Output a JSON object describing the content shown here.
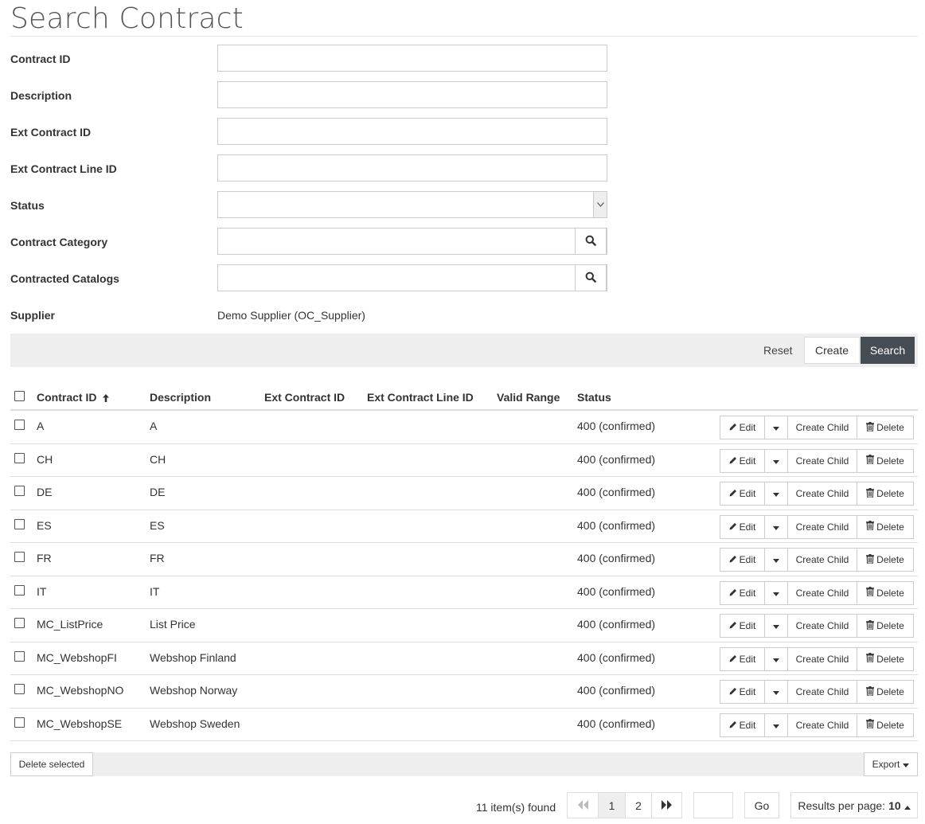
{
  "page": {
    "title": "Search Contract"
  },
  "form": {
    "contract_id": {
      "label": "Contract ID",
      "value": ""
    },
    "description": {
      "label": "Description",
      "value": ""
    },
    "ext_contract_id": {
      "label": "Ext Contract ID",
      "value": ""
    },
    "ext_contract_line_id": {
      "label": "Ext Contract Line ID",
      "value": ""
    },
    "status": {
      "label": "Status",
      "value": ""
    },
    "contract_category": {
      "label": "Contract Category",
      "value": ""
    },
    "contracted_catalogs": {
      "label": "Contracted Catalogs",
      "value": ""
    },
    "supplier": {
      "label": "Supplier",
      "value": "Demo Supplier (OC_Supplier)"
    }
  },
  "actions": {
    "reset": "Reset",
    "create": "Create",
    "search": "Search"
  },
  "table": {
    "columns": [
      "Contract ID",
      "Description",
      "Ext Contract ID",
      "Ext Contract Line ID",
      "Valid Range",
      "Status"
    ],
    "sort_indicator": "ascending",
    "row_buttons": {
      "edit": "Edit",
      "create_child": "Create Child",
      "delete": "Delete"
    },
    "rows": [
      {
        "id": "A",
        "description": "A",
        "status": "400 (confirmed)"
      },
      {
        "id": "CH",
        "description": "CH",
        "status": "400 (confirmed)"
      },
      {
        "id": "DE",
        "description": "DE",
        "status": "400 (confirmed)"
      },
      {
        "id": "ES",
        "description": "ES",
        "status": "400 (confirmed)"
      },
      {
        "id": "FR",
        "description": "FR",
        "status": "400 (confirmed)"
      },
      {
        "id": "IT",
        "description": "IT",
        "status": "400 (confirmed)"
      },
      {
        "id": "MC_ListPrice",
        "description": "List Price",
        "status": "400 (confirmed)"
      },
      {
        "id": "MC_WebshopFI",
        "description": "Webshop Finland",
        "status": "400 (confirmed)"
      },
      {
        "id": "MC_WebshopNO",
        "description": "Webshop Norway",
        "status": "400 (confirmed)"
      },
      {
        "id": "MC_WebshopSE",
        "description": "Webshop Sweden",
        "status": "400 (confirmed)"
      }
    ]
  },
  "bottom": {
    "delete_selected": "Delete selected",
    "export": "Export"
  },
  "pagination": {
    "items_found": "11 item(s) found",
    "pages": [
      "1",
      "2"
    ],
    "current_page": "1",
    "goto_value": "",
    "go_label": "Go",
    "results_per_page_label": "Results per page:",
    "results_per_page_value": "10"
  },
  "colors": {
    "search_button_bg": "#464c54",
    "bar_bg": "#eeeeee",
    "active_page_bg": "#eeeeee"
  }
}
